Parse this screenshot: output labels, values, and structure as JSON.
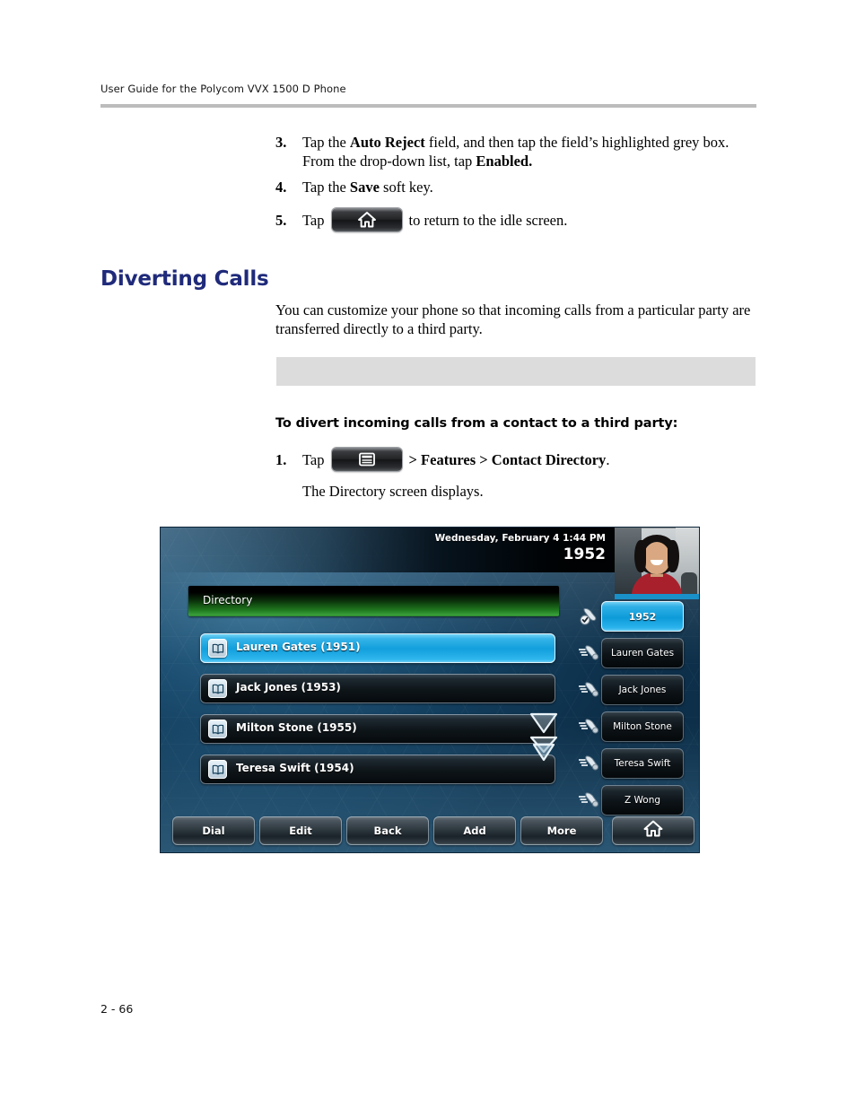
{
  "header": {
    "running_head": "User Guide for the Polycom VVX 1500 D Phone"
  },
  "footer": {
    "page_number": "2 - 66"
  },
  "steps_top": [
    {
      "number": "3.",
      "text_a": "Tap the ",
      "bold_a": "Auto Reject",
      "text_b": " field, and then tap the field’s highlighted grey box. From the drop-down list, tap ",
      "bold_b": "Enabled."
    },
    {
      "number": "4.",
      "text_a": "Tap the ",
      "bold_a": "Save",
      "text_b": " soft key.",
      "bold_b": ""
    },
    {
      "number": "5.",
      "text_a": "Tap",
      "icon": "home-key-icon",
      "text_b": "to return to the idle screen."
    }
  ],
  "section": {
    "heading": "Diverting Calls",
    "paragraph": "You can customize your phone so that incoming calls from a particular party are transferred directly to a third party.",
    "note_box_text": ""
  },
  "procedure": {
    "title": "To divert incoming calls from a contact to a third party:",
    "step_number": "1.",
    "step_text_a": "Tap",
    "step_icon": "menu-key-icon",
    "step_text_b": "> Features > Contact Directory",
    "step_text_c": ".",
    "result_line": "The Directory screen displays."
  },
  "phone_screen": {
    "status": {
      "date_time": "Wednesday, February 4  1:44 PM",
      "extension": "1952",
      "video_thumbnail": "self-view-video-thumbnail"
    },
    "title_bar": {
      "label": "Directory"
    },
    "contacts": [
      {
        "label": "Lauren Gates (1951)",
        "icon": "contact-book-icon",
        "selected": true
      },
      {
        "label": "Jack Jones (1953)",
        "icon": "contact-book-icon",
        "selected": false
      },
      {
        "label": "Milton Stone (1955)",
        "icon": "contact-book-icon",
        "selected": false
      },
      {
        "label": "Teresa Swift (1954)",
        "icon": "contact-book-icon",
        "selected": false
      }
    ],
    "scroll_arrows": [
      "scroll-down-icon",
      "scroll-page-down-icon"
    ],
    "line_keys": [
      {
        "label": "1952",
        "icon": "handset-registered-icon",
        "active": true
      },
      {
        "label": "Lauren Gates",
        "icon": "handset-icon",
        "active": false
      },
      {
        "label": "Jack Jones",
        "icon": "handset-icon",
        "active": false
      },
      {
        "label": "Milton Stone",
        "icon": "handset-icon",
        "active": false
      },
      {
        "label": "Teresa Swift",
        "icon": "handset-icon",
        "active": false
      },
      {
        "label": "Z Wong",
        "icon": "handset-icon",
        "active": false
      }
    ],
    "soft_keys": [
      "Dial",
      "Edit",
      "Back",
      "Add",
      "More"
    ],
    "home_soft_key": "home-icon"
  },
  "colors": {
    "heading_blue": "#1f2a7a",
    "note_grey": "#dcdcdc",
    "rule_grey": "#bcbcbc",
    "selection_blue": "#129fdc",
    "title_green": "#1f7a1f"
  }
}
